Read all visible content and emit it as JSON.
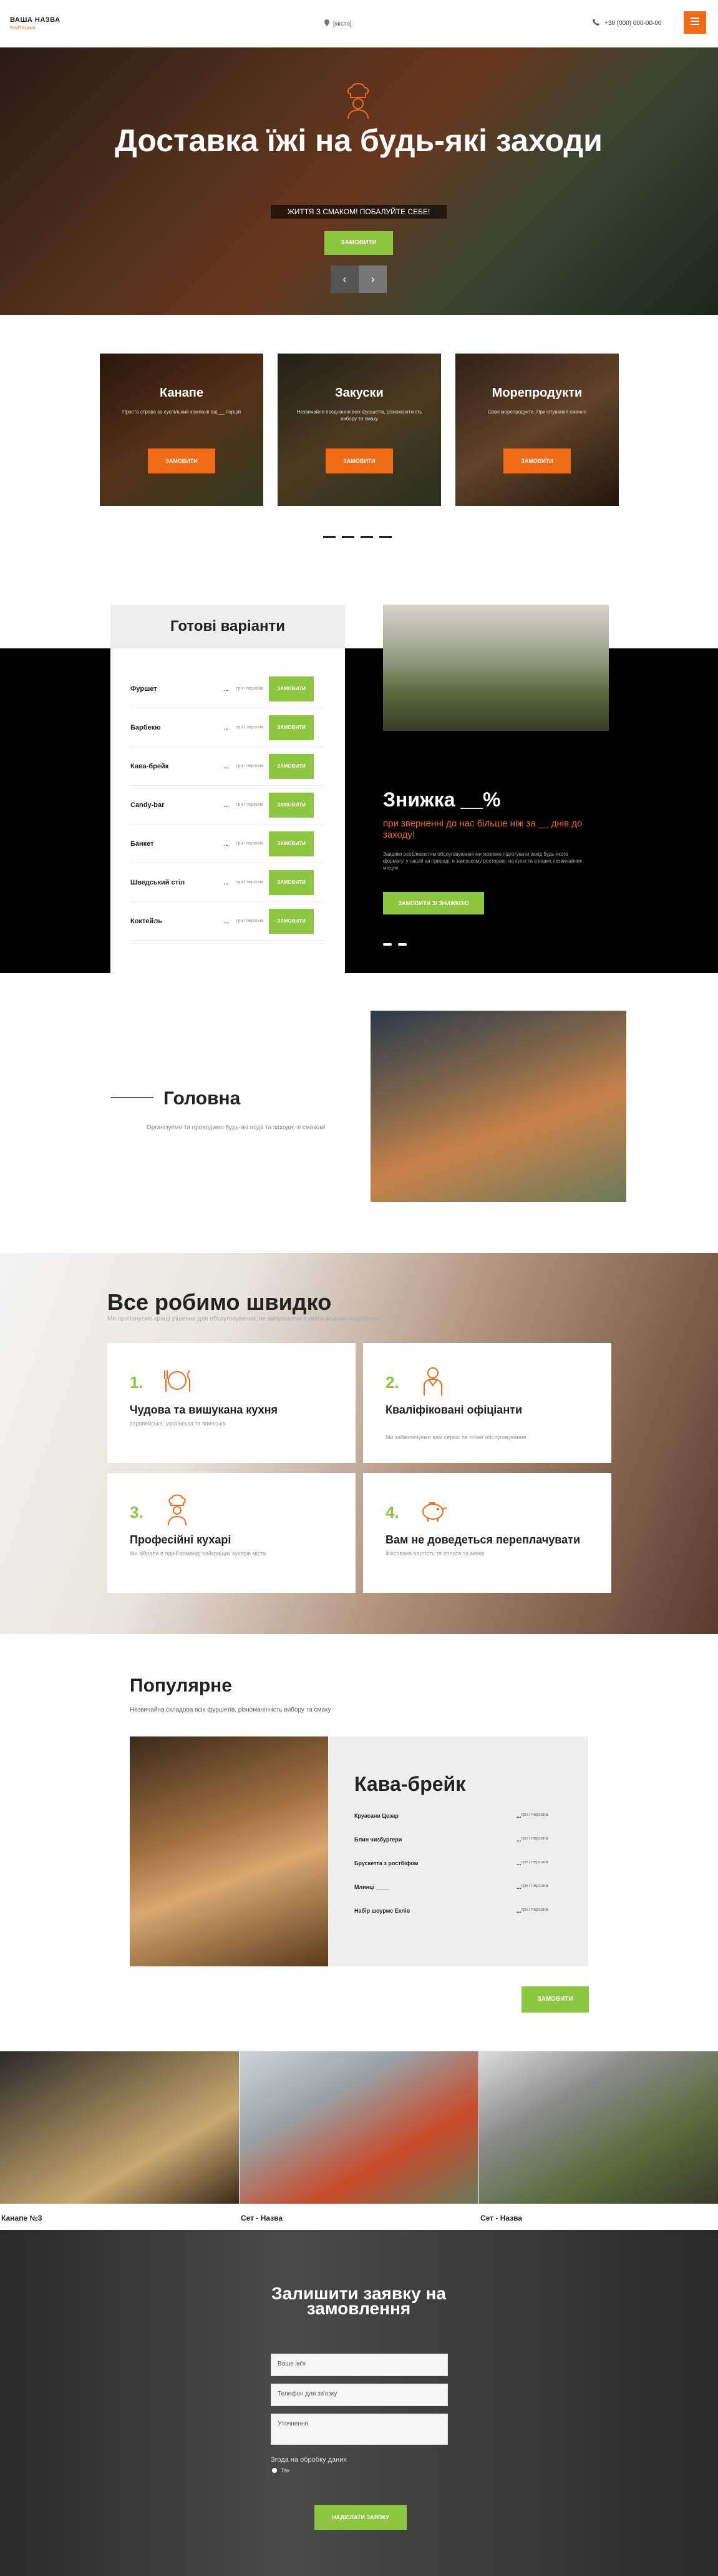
{
  "header": {
    "brand": "ВАША НАЗВА",
    "brand_sub": "Кейтеринг",
    "city": "[місто]",
    "phone": "+38 (000) 000-00-00"
  },
  "hero": {
    "title": "Доставка їжі на будь-які заходи",
    "tagline": "ЖИТТЯ З СМАКОМ! ПОБАЛУЙТЕ СЕБЕ!",
    "button": "ЗАМОВИТИ",
    "arrow_prev": "‹",
    "arrow_next": "›"
  },
  "categories": [
    {
      "title": "Канапе",
      "text": "Проста страва за суспільний компанії від __ порцій",
      "button": "ЗАМОВИТИ"
    },
    {
      "title": "Закуски",
      "text": "Незвичайне поєднання всіх фуршетів, різноманітність вибору та смаку",
      "button": "ЗАМОВИТИ"
    },
    {
      "title": "Морепродукти",
      "text": "Свіжі морепродукти. Приготування смачно",
      "button": "ЗАМОВИТИ"
    }
  ],
  "variants": {
    "title": "Готові варіанти",
    "price_label": "грн / персона",
    "dots": "...",
    "items": [
      {
        "name": "Фуршет",
        "button": "ЗАМОВИТИ"
      },
      {
        "name": "Барбекю",
        "button": "ЗАМОВИТИ"
      },
      {
        "name": "Кава-брейк",
        "button": "ЗАМОВИТИ"
      },
      {
        "name": "Candy-bar",
        "button": "ЗАМОВИТИ"
      },
      {
        "name": "Банкет",
        "button": "ЗАМОВИТИ"
      },
      {
        "name": "Шведський стіл",
        "button": "ЗАМОВИТИ"
      },
      {
        "name": "Коктейль",
        "button": "ЗАМОВИТИ"
      }
    ]
  },
  "discount": {
    "title": "Знижка __%",
    "subtitle": "при зверненні до нас більше ніж за __ днів до заходу!",
    "text": "Завдяки особливостям обслуговування ми можемо підготувати захід будь-якого формату, у нашій на природі, в заміському ресторані, на кухні та в інших незвичайних місцях.",
    "button": "ЗАМОВИТИ ЗІ ЗНИЖКОЮ"
  },
  "main_section": {
    "title": "Головна",
    "text": "Організуємо та проводимо будь-які події та заходи, зі смаком!"
  },
  "fast": {
    "title": "Все робимо швидко",
    "subtitle": "Ми пропонуємо кращі рішення для обслуговування, не випускаючи з уваги жодних подробиць",
    "cards": [
      {
        "num": "1.",
        "title": "Чудова та вишукана кухня",
        "text": "європейська, українська та японська"
      },
      {
        "num": "2.",
        "title": "Кваліфіковані офіціанти",
        "text": "Ми забезпечуємо вам сервіс та точне обслуговування"
      },
      {
        "num": "3.",
        "title": "Професійні кухарі",
        "text": "Ми зібрали в одній команді найкращих кухарів міста"
      },
      {
        "num": "4.",
        "title": "Вам не доведеться переплачувати",
        "text": "Фіксована вартість та оплата за меню"
      }
    ]
  },
  "popular": {
    "title": "Популярне",
    "subtitle": "Незвичайна складова всіх фуршетів, різноманітність вибору та смаку",
    "card_title": "Кава-брейк",
    "price_label": "грн / персона",
    "dots": "...",
    "items": [
      "Круасани Цезар",
      "Блин чизбургери",
      "Брускетта з ростбіфом",
      "Млинці ____",
      "Набір шоурмс Еклів"
    ],
    "button": "ЗАМОВИТИ"
  },
  "sets": [
    "Канапе №3",
    "Сет - Назва",
    "Сет - Назва"
  ],
  "form": {
    "title": "Залишити заявку на замовлення",
    "name_ph": "Ваше ім'я",
    "phone_ph": "Телефон для зв'язку",
    "notes_ph": "Уточнення",
    "agree": "Згода на обробку даних",
    "yes": "Так",
    "button": "НАДІСЛАТИ ЗАЯВКУ"
  },
  "colors": {
    "accent_orange": "#f06b16",
    "accent_green": "#8dc63f",
    "dark": "#000000"
  }
}
